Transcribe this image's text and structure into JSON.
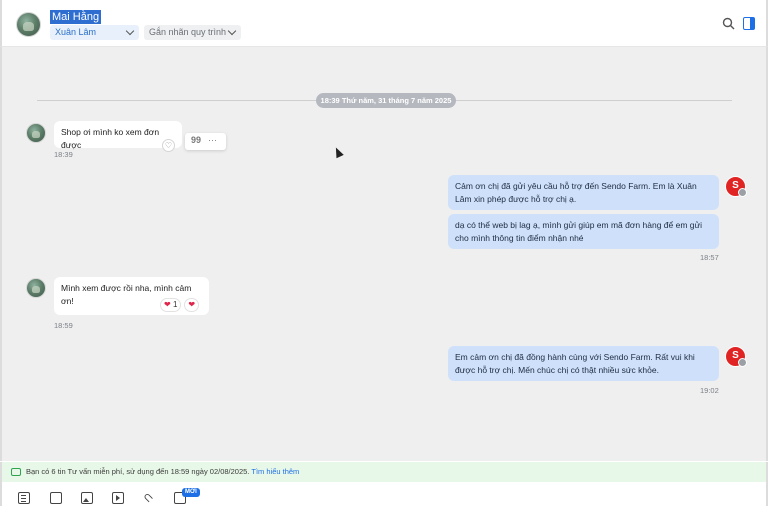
{
  "header": {
    "contact_name": "Mai Hằng",
    "staff_select": "Xuân Lâm",
    "tag_select": "Gắn nhãn quy trình"
  },
  "chat": {
    "date_separator": "18:39 Thứ năm, 31 tháng 7 năm 2025",
    "messages": [
      {
        "from": "customer",
        "text": "Shop ơi mình ko xem đơn được",
        "time": "18:39"
      },
      {
        "from": "shop",
        "text": "Cảm ơn chị đã gửi yêu cầu hỗ trợ đến Sendo Farm. Em là Xuân Lâm xin phép được hỗ trợ chị ạ."
      },
      {
        "from": "shop",
        "text": "dạ có thể web bị lag ạ, mình gửi giúp em mã đơn hàng để em gửi cho mình thông tin điểm nhận nhé",
        "time": "18:57"
      },
      {
        "from": "customer",
        "text": "Mình xem được rồi nha, mình cảm ơn!",
        "time": "18:59",
        "reaction_count": "1"
      },
      {
        "from": "shop",
        "text": "Em cảm ơn chị đã đồng hành cùng với Sendo Farm. Rất vui khi được hỗ trợ chị. Mến chúc chị có thật nhiều sức khỏe.",
        "time": "19:02"
      }
    ],
    "quote_glyph": "99",
    "more_glyph": "···"
  },
  "notice": {
    "text": "Bạn có 6 tin Tư vấn miễn phí, sử dụng đến 18:59 ngày 02/08/2025.",
    "link": "Tìm hiểu thêm"
  },
  "composer": {
    "new_badge": "MỚI"
  },
  "colors": {
    "accent": "#1e6fe6",
    "outgoing_bubble": "#cfe1fa",
    "shop_avatar": "#e02424",
    "notice_bg": "#e8f8e8"
  }
}
